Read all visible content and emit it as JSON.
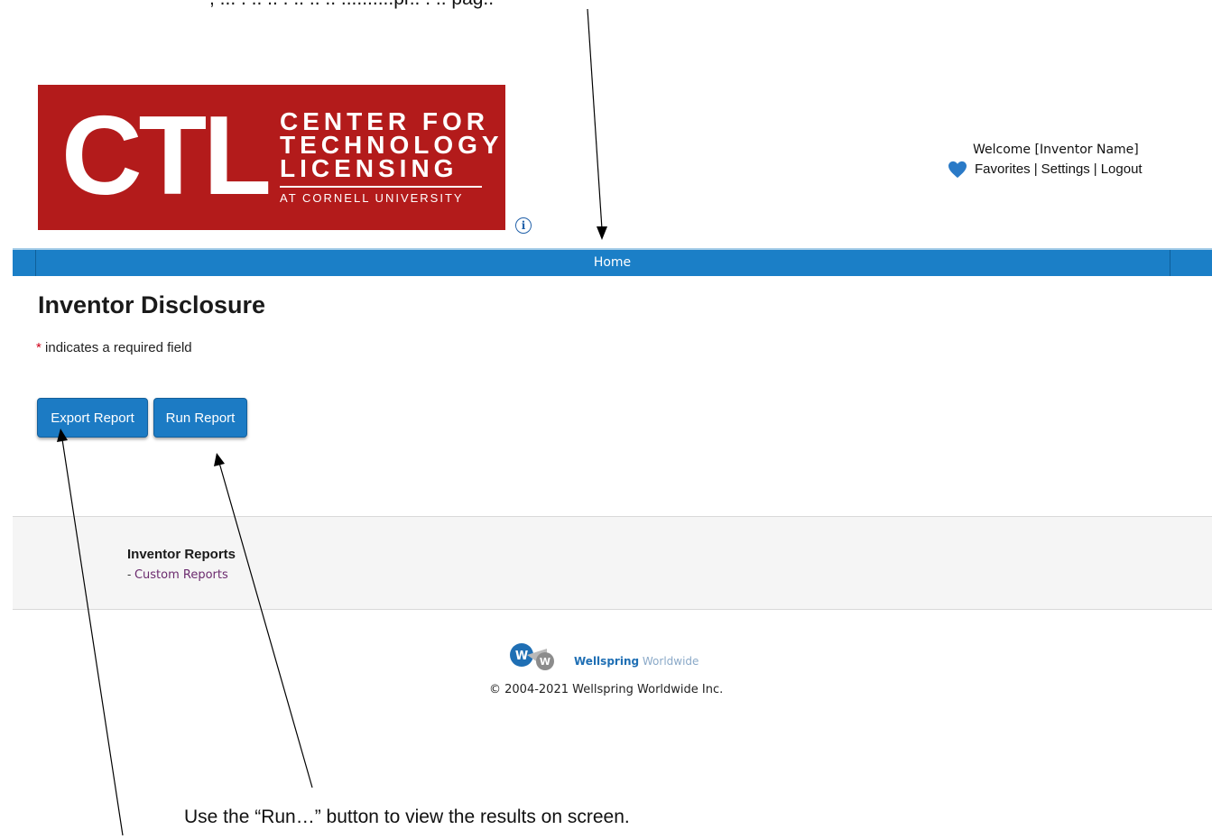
{
  "callouts": {
    "top": ", ... . .. .. . .. .. .. ..........pr.. . .. pag..",
    "run": "Use the “Run…” button to view the results on screen."
  },
  "logo": {
    "abbr": "CTL",
    "line1": "CENTER FOR",
    "line2": "TECHNOLOGY",
    "line3": "LICENSING",
    "line4": "AT CORNELL UNIVERSITY",
    "color": "#b31b1b"
  },
  "header": {
    "welcome": "Welcome [Inventor Name]",
    "favorites": "Favorites",
    "settings": "Settings",
    "logout": "Logout",
    "separator": "|"
  },
  "nav": {
    "home": "Home",
    "color": "#1b7fc7"
  },
  "page": {
    "title": "Inventor Disclosure",
    "required_star": "*",
    "required_note": "indicates a required field"
  },
  "buttons": {
    "export": "Export Report",
    "run": "Run Report"
  },
  "reports": {
    "title": "Inventor Reports",
    "link_prefix": "- ",
    "link": "Custom Reports"
  },
  "footer": {
    "brand_bold": "Wellspring",
    "brand_light": " Worldwide",
    "copyright": "© 2004-2021 Wellspring Worldwide Inc."
  },
  "icons": {
    "info": "info-icon",
    "heart": "heart-icon"
  }
}
